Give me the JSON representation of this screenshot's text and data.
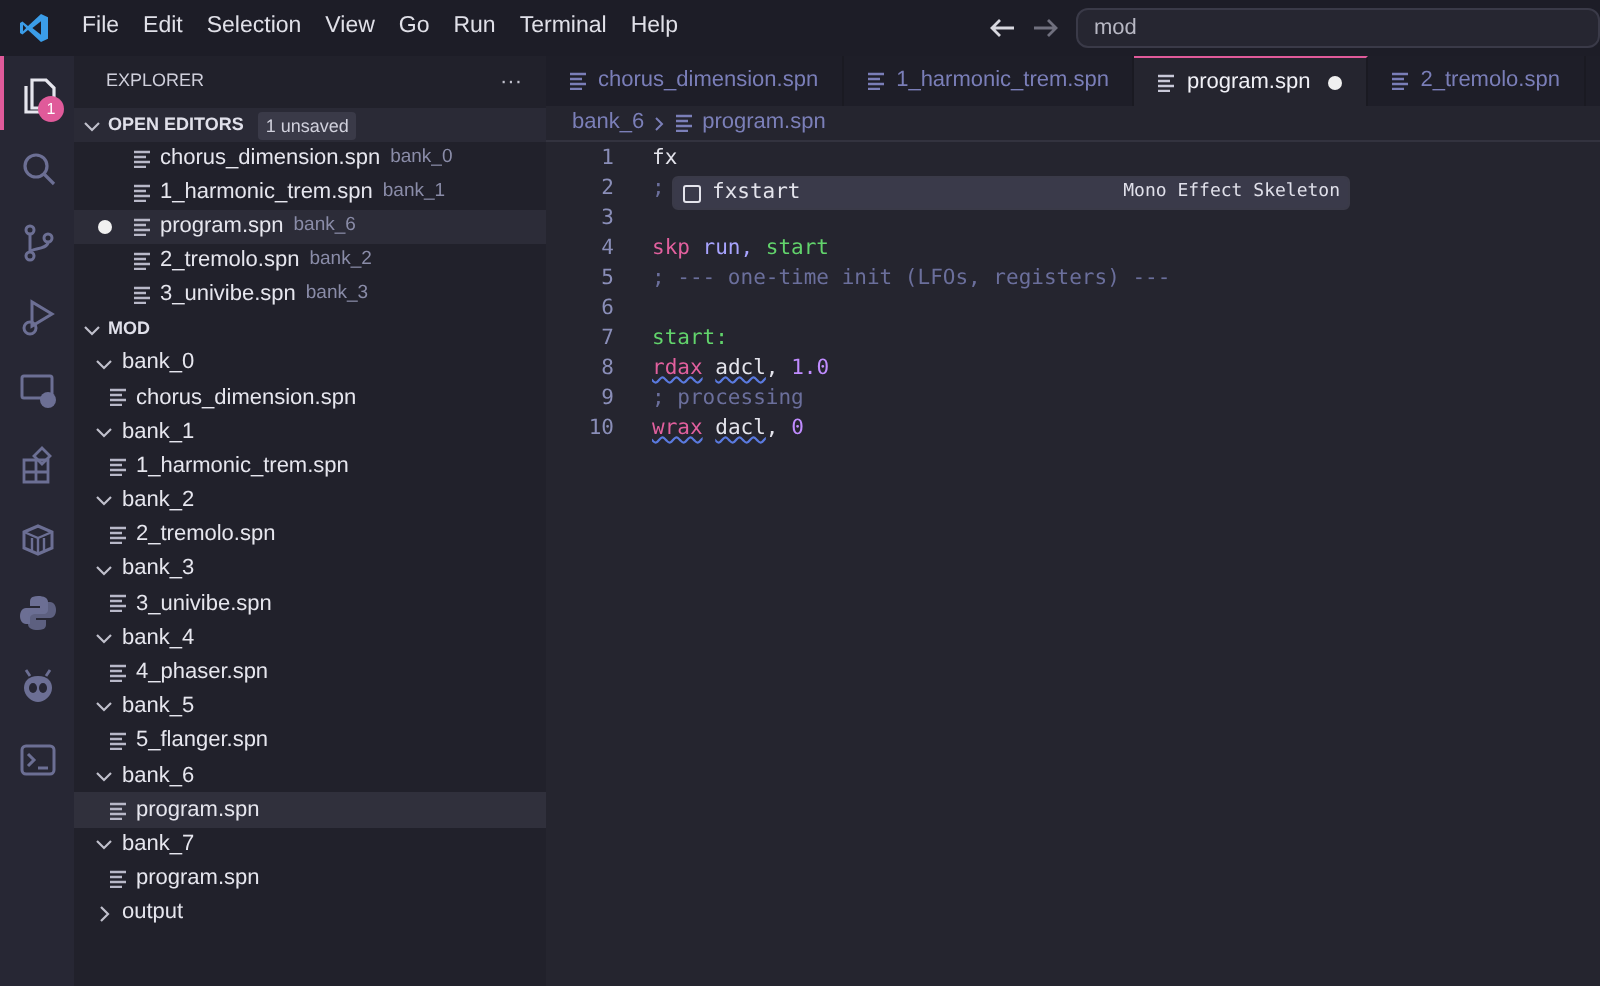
{
  "menu": [
    "File",
    "Edit",
    "Selection",
    "View",
    "Go",
    "Run",
    "Terminal",
    "Help"
  ],
  "search": {
    "value": "mod"
  },
  "activity_bar": [
    {
      "kind": "files",
      "selected": true,
      "badge": "1"
    },
    {
      "kind": "search",
      "selected": false
    },
    {
      "kind": "branch",
      "selected": false
    },
    {
      "kind": "debug",
      "selected": false
    },
    {
      "kind": "remote",
      "selected": false
    },
    {
      "kind": "extensions",
      "selected": false
    },
    {
      "kind": "box",
      "selected": false
    },
    {
      "kind": "python",
      "selected": false
    },
    {
      "kind": "alien",
      "selected": false
    },
    {
      "kind": "terminal",
      "selected": false
    }
  ],
  "sidebar": {
    "title": "EXPLORER",
    "more": "···",
    "open_editors": {
      "title": "OPEN EDITORS",
      "badge": "1 unsaved",
      "expanded": true,
      "items": [
        {
          "name": "chorus_dimension.spn",
          "folder": "bank_0",
          "dirty": false,
          "selected": false
        },
        {
          "name": "1_harmonic_trem.spn",
          "folder": "bank_1",
          "dirty": false,
          "selected": false
        },
        {
          "name": "program.spn",
          "folder": "bank_6",
          "dirty": true,
          "selected": true
        },
        {
          "name": "2_tremolo.spn",
          "folder": "bank_2",
          "dirty": false,
          "selected": false
        },
        {
          "name": "3_univibe.spn",
          "folder": "bank_3",
          "dirty": false,
          "selected": false
        }
      ]
    },
    "folder": {
      "title": "MOD",
      "expanded": true,
      "children": [
        {
          "name": "bank_0",
          "kind": "folder",
          "expanded": true,
          "children": [
            {
              "name": "chorus_dimension.spn",
              "kind": "file",
              "selected": false
            }
          ]
        },
        {
          "name": "bank_1",
          "kind": "folder",
          "expanded": true,
          "children": [
            {
              "name": "1_harmonic_trem.spn",
              "kind": "file",
              "selected": false
            }
          ]
        },
        {
          "name": "bank_2",
          "kind": "folder",
          "expanded": true,
          "children": [
            {
              "name": "2_tremolo.spn",
              "kind": "file",
              "selected": false
            }
          ]
        },
        {
          "name": "bank_3",
          "kind": "folder",
          "expanded": true,
          "children": [
            {
              "name": "3_univibe.spn",
              "kind": "file",
              "selected": false
            }
          ]
        },
        {
          "name": "bank_4",
          "kind": "folder",
          "expanded": true,
          "children": [
            {
              "name": "4_phaser.spn",
              "kind": "file",
              "selected": false
            }
          ]
        },
        {
          "name": "bank_5",
          "kind": "folder",
          "expanded": true,
          "children": [
            {
              "name": "5_flanger.spn",
              "kind": "file",
              "selected": false
            }
          ]
        },
        {
          "name": "bank_6",
          "kind": "folder",
          "expanded": true,
          "children": [
            {
              "name": "program.spn",
              "kind": "file",
              "selected": true
            }
          ]
        },
        {
          "name": "bank_7",
          "kind": "folder",
          "expanded": true,
          "children": [
            {
              "name": "program.spn",
              "kind": "file",
              "selected": false
            }
          ]
        },
        {
          "name": "output",
          "kind": "folder",
          "expanded": false
        }
      ]
    }
  },
  "tabs": [
    {
      "label": "chorus_dimension.spn",
      "selected": false,
      "dirty": false
    },
    {
      "label": "1_harmonic_trem.spn",
      "selected": false,
      "dirty": false
    },
    {
      "label": "program.spn",
      "selected": true,
      "dirty": true
    },
    {
      "label": "2_tremolo.spn",
      "selected": false,
      "dirty": false
    }
  ],
  "breadcrumb": [
    "bank_6",
    "program.spn"
  ],
  "editor": {
    "lines": [
      {
        "number": "1",
        "tokens": [
          {
            "text": "fx",
            "kind": "plain"
          }
        ]
      },
      {
        "number": "2",
        "tokens": [
          {
            "text": ";",
            "kind": "comment"
          }
        ]
      },
      {
        "number": "3"
      },
      {
        "number": "4",
        "tokens": [
          {
            "text": "skp",
            "kind": "keyword"
          },
          {
            "text": " run,",
            "kind": "ident"
          },
          {
            "text": " start",
            "kind": "label"
          }
        ]
      },
      {
        "number": "5",
        "tokens": [
          {
            "text": "; --- one-time init (LFOs, registers) ---",
            "kind": "comment"
          }
        ]
      },
      {
        "number": "6"
      },
      {
        "number": "7",
        "tokens": [
          {
            "text": "start:",
            "kind": "label"
          }
        ]
      },
      {
        "number": "8",
        "tokens": [
          {
            "text": "rdax",
            "kind": "keyword",
            "squiggle": true
          },
          {
            "text": " adcl",
            "kind": "plain",
            "squiggle": true,
            "lead": true
          },
          {
            "text": ", ",
            "kind": "plain"
          },
          {
            "text": "1.0",
            "kind": "number"
          }
        ]
      },
      {
        "number": "9",
        "tokens": [
          {
            "text": "; processing",
            "kind": "comment"
          }
        ]
      },
      {
        "number": "10",
        "tokens": [
          {
            "text": "wrax",
            "kind": "keyword",
            "squiggle": true
          },
          {
            "text": " dacl",
            "kind": "plain",
            "squiggle": true,
            "lead": true
          },
          {
            "text": ", ",
            "kind": "plain"
          },
          {
            "text": "0",
            "kind": "number"
          }
        ]
      }
    ],
    "suggestion": {
      "label": "fxstart",
      "detail": "Mono Effect Skeleton",
      "selected": true
    }
  }
}
